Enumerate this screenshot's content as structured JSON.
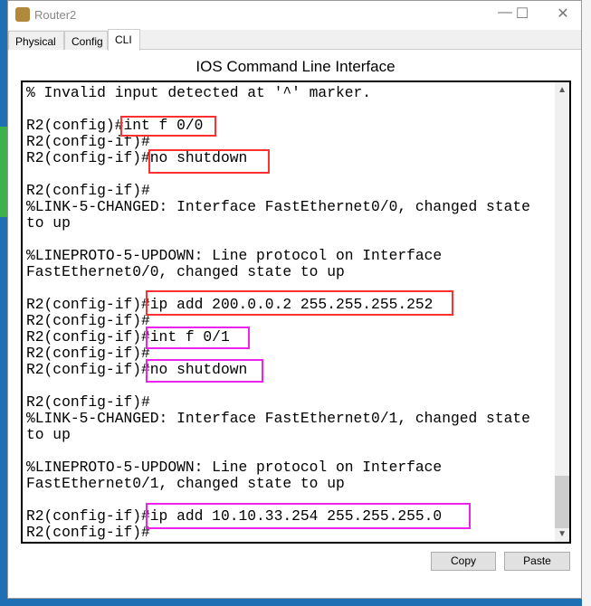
{
  "window": {
    "title": "Router2",
    "minimize": "—",
    "maximize": "☐",
    "close": "✕"
  },
  "tabs": [
    {
      "label": "Physical"
    },
    {
      "label": "Config"
    },
    {
      "label": "CLI",
      "active": true
    }
  ],
  "heading": "IOS Command Line Interface",
  "terminal": {
    "lines": [
      "% Invalid input detected at '^' marker.",
      "",
      "R2(config)#int f 0/0",
      "R2(config-if)#",
      "R2(config-if)#no shutdown",
      "",
      "R2(config-if)#",
      "%LINK-5-CHANGED: Interface FastEthernet0/0, changed state",
      "to up",
      "",
      "%LINEPROTO-5-UPDOWN: Line protocol on Interface",
      "FastEthernet0/0, changed state to up",
      "",
      "R2(config-if)#ip add 200.0.0.2 255.255.255.252",
      "R2(config-if)#",
      "R2(config-if)#int f 0/1",
      "R2(config-if)#",
      "R2(config-if)#no shutdown",
      "",
      "R2(config-if)#",
      "%LINK-5-CHANGED: Interface FastEthernet0/1, changed state",
      "to up",
      "",
      "%LINEPROTO-5-UPDOWN: Line protocol on Interface",
      "FastEthernet0/1, changed state to up",
      "",
      "R2(config-if)#ip add 10.10.33.254 255.255.255.0",
      "R2(config-if)#"
    ]
  },
  "highlight_colors": {
    "red": "#ff3030",
    "magenta": "#ee22ee"
  },
  "buttons": {
    "copy": "Copy",
    "paste": "Paste"
  }
}
